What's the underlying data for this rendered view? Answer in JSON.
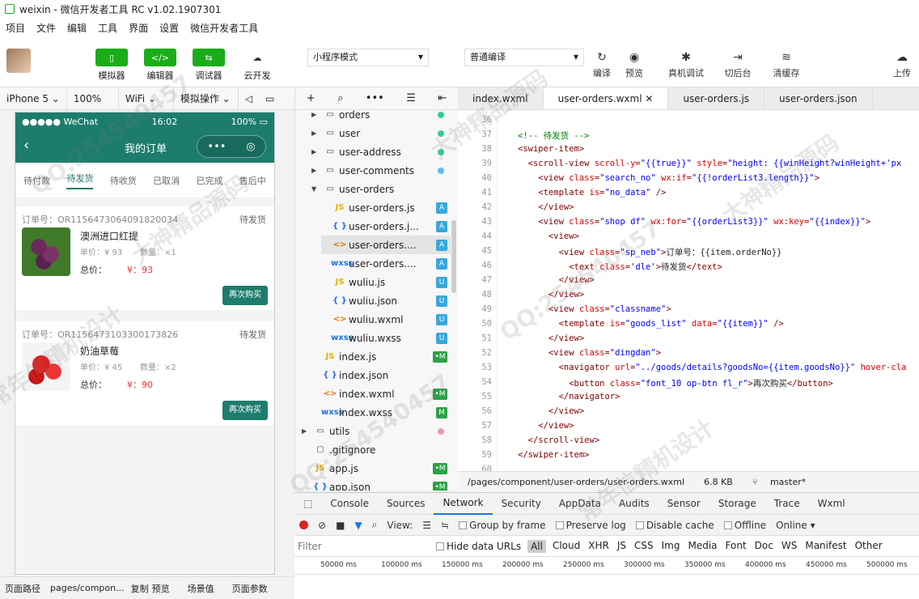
{
  "window": {
    "title": "weixin - 微信开发者工具 RC v1.02.1907301"
  },
  "menu": [
    "项目",
    "文件",
    "编辑",
    "工具",
    "界面",
    "设置",
    "微信开发者工具"
  ],
  "toolbar": {
    "simulator": "模拟器",
    "editor": "编辑器",
    "debugger": "调试器",
    "cloud": "云开发",
    "mode": "小程序模式",
    "compile": "普通编译",
    "compile_btn": "编译",
    "preview": "预览",
    "remote_debug": "真机调试",
    "backend": "切后台",
    "clear_cache": "清缓存",
    "upload": "上传"
  },
  "device_bar": {
    "device": "iPhone 5",
    "zoom": "100%",
    "network": "WiFi",
    "operation": "模拟操作"
  },
  "phone": {
    "status_left": "●●●●● WeChat",
    "time": "16:02",
    "battery": "100%",
    "nav_title": "我的订单",
    "tabs": [
      "待付款",
      "待发货",
      "待收货",
      "已取消",
      "已完成",
      "售后中"
    ],
    "active_tab": "待发货",
    "orders": [
      {
        "order_no": "订单号：OR1156473064091820034",
        "status": "待发货",
        "name": "澳洲进口红提",
        "price": "单价：¥ 93",
        "qty": "数量：×1",
        "total_label": "总价：",
        "total": "¥：93",
        "button": "再次购买"
      },
      {
        "order_no": "订单号：OR1156473103300173826",
        "status": "待发货",
        "name": "奶油草莓",
        "price": "单价：¥ 45",
        "qty": "数量：×2",
        "total_label": "总价：",
        "total": "¥：90",
        "button": "再次购买"
      }
    ]
  },
  "bottom_bar": {
    "path_label": "页面路径",
    "path": "pages/compon...",
    "copy": "复制",
    "preview": "预览",
    "scene": "场景值",
    "params": "页面参数"
  },
  "file_tree": [
    {
      "name": "orders",
      "type": "folder",
      "depth": 1,
      "dot": "#3c9"
    },
    {
      "name": "user",
      "type": "folder",
      "depth": 1,
      "dot": "#3c9"
    },
    {
      "name": "user-address",
      "type": "folder",
      "depth": 1,
      "dot": "#3c9"
    },
    {
      "name": "user-comments",
      "type": "folder",
      "depth": 1,
      "dot": "#5bc0eb"
    },
    {
      "name": "user-orders",
      "type": "folder-open",
      "depth": 1,
      "dot": ""
    },
    {
      "name": "user-orders.js",
      "type": "js",
      "depth": 2,
      "badge": "A"
    },
    {
      "name": "user-orders.j...",
      "type": "json",
      "depth": 2,
      "badge": "A"
    },
    {
      "name": "user-orders....",
      "type": "wxml",
      "depth": 2,
      "badge": "A"
    },
    {
      "name": "user-orders....",
      "type": "wxss",
      "depth": 2,
      "badge": "A"
    },
    {
      "name": "wuliu.js",
      "type": "js",
      "depth": 2,
      "badge": "U"
    },
    {
      "name": "wuliu.json",
      "type": "json",
      "depth": 2,
      "badge": "U"
    },
    {
      "name": "wuliu.wxml",
      "type": "wxml",
      "depth": 2,
      "badge": "U"
    },
    {
      "name": "wuliu.wxss",
      "type": "wxss",
      "depth": 2,
      "badge": "U"
    },
    {
      "name": "index.js",
      "type": "js",
      "depth": 1,
      "badge": "•M"
    },
    {
      "name": "index.json",
      "type": "json",
      "depth": 1,
      "badge": ""
    },
    {
      "name": "index.wxml",
      "type": "wxml",
      "depth": 1,
      "badge": "•M"
    },
    {
      "name": "index.wxss",
      "type": "wxss",
      "depth": 1,
      "badge": "M"
    },
    {
      "name": "utils",
      "type": "folder",
      "depth": 0,
      "dot": "#e9a"
    },
    {
      "name": ".gitignore",
      "type": "file",
      "depth": 0,
      "badge": ""
    },
    {
      "name": "app.js",
      "type": "js",
      "depth": 0,
      "badge": "•M"
    },
    {
      "name": "app.json",
      "type": "json",
      "depth": 0,
      "badge": "•M"
    }
  ],
  "editor_tabs": [
    "index.wxml",
    "user-orders.wxml",
    "user-orders.js",
    "user-orders.json"
  ],
  "active_editor_tab": "user-orders.wxml",
  "code_lines": [
    {
      "n": "36",
      "html": ""
    },
    {
      "n": "37",
      "html": "<span class=\"c\">&lt;!-- 待发货 --&gt;</span>"
    },
    {
      "n": "38",
      "html": "&lt;swiper-item&gt;"
    },
    {
      "n": "39",
      "html": "  &lt;scroll-view <span class=\"a\">scroll-y</span>=<span class=\"v\">\"{{true}}\"</span> <span class=\"a\">style</span>=<span class=\"v\">\"height: {{winHeight?winHeight+'px</span>"
    },
    {
      "n": "40",
      "html": "    &lt;view <span class=\"a\">class</span>=<span class=\"v\">\"search_no\"</span> <span class=\"a\">wx:if</span>=<span class=\"v\">\"{{!orderList3.length}}\"</span>&gt;"
    },
    {
      "n": "41",
      "html": "     &lt;template <span class=\"a\">is</span>=<span class=\"v\">\"no_data\"</span> /&gt;"
    },
    {
      "n": "42",
      "html": "    &lt;/view&gt;"
    },
    {
      "n": "43",
      "html": "    &lt;view <span class=\"a\">class</span>=<span class=\"v\">\"shop df\"</span> <span class=\"a\">wx:for</span>=<span class=\"v\">\"{{orderList3}}\"</span> <span class=\"a\">wx:key</span>=<span class=\"v\">\"{{index}}\"</span>&gt;"
    },
    {
      "n": "44",
      "html": "      &lt;view&gt;"
    },
    {
      "n": "45",
      "html": "        &lt;view <span class=\"a\">class</span>=<span class=\"v\">\"sp_neb\"</span>&gt;<span class=\"t\">订单号：{{item.orderNo}}</span>"
    },
    {
      "n": "46",
      "html": "          &lt;text <span class=\"a\">class</span>=<span class=\"v\">'dle'</span>&gt;<span class=\"t\">待发货</span>&lt;/text&gt;"
    },
    {
      "n": "47",
      "html": "        &lt;/view&gt;"
    },
    {
      "n": "48",
      "html": "      &lt;/view&gt;"
    },
    {
      "n": "49",
      "html": "      &lt;view <span class=\"a\">class</span>=<span class=\"v\">\"classname\"</span>&gt;"
    },
    {
      "n": "50",
      "html": "        &lt;template <span class=\"a\">is</span>=<span class=\"v\">\"goods_list\"</span> <span class=\"a\">data</span>=<span class=\"v\">\"{{item}}\"</span> /&gt;"
    },
    {
      "n": "51",
      "html": "      &lt;/view&gt;"
    },
    {
      "n": "52",
      "html": "      &lt;view <span class=\"a\">class</span>=<span class=\"v\">\"dingdan\"</span>&gt;"
    },
    {
      "n": "53",
      "html": "        &lt;navigator <span class=\"a\">url</span>=<span class=\"v\">\"../goods/details?goodsNo={{item.goodsNo}}\"</span> <span class=\"a\">hover-cla</span>"
    },
    {
      "n": "54",
      "html": "          &lt;button <span class=\"a\">class</span>=<span class=\"v\">\"font_10 op-btn fl_r\"</span>&gt;<span class=\"t\">再次购买</span>&lt;/button&gt;"
    },
    {
      "n": "55",
      "html": "        &lt;/navigator&gt;"
    },
    {
      "n": "56",
      "html": "      &lt;/view&gt;"
    },
    {
      "n": "57",
      "html": "    &lt;/view&gt;"
    },
    {
      "n": "58",
      "html": "  &lt;/scroll-view&gt;"
    },
    {
      "n": "59",
      "html": "&lt;/swiper-item&gt;"
    },
    {
      "n": "60",
      "html": ""
    }
  ],
  "editor_status": {
    "path": "/pages/component/user-orders/user-orders.wxml",
    "size": "6.8 KB",
    "branch": "master*"
  },
  "devtools_tabs": [
    "Console",
    "Sources",
    "Network",
    "Security",
    "AppData",
    "Audits",
    "Sensor",
    "Storage",
    "Trace",
    "Wxml"
  ],
  "active_devtools_tab": "Network",
  "network_toolbar": {
    "view_label": "View:",
    "group": "Group by frame",
    "preserve": "Preserve log",
    "disable_cache": "Disable cache",
    "offline": "Offline",
    "online": "Online"
  },
  "filter": {
    "placeholder": "Filter",
    "hide_data": "Hide data URLs",
    "types": [
      "All",
      "Cloud",
      "XHR",
      "JS",
      "CSS",
      "Img",
      "Media",
      "Font",
      "Doc",
      "WS",
      "Manifest",
      "Other"
    ]
  },
  "timeline_ticks": [
    "50000 ms",
    "100000 ms",
    "150000 ms",
    "200000 ms",
    "250000 ms",
    "300000 ms",
    "350000 ms",
    "400000 ms",
    "450000 ms",
    "500000 ms"
  ],
  "watermarks": [
    "QQ:254540457",
    "大神精品源码",
    "常年信精机设计",
    "QQ:254540457",
    "大神精品源码",
    "常年信精机设计",
    "QQ:254540457",
    "大神精品源码"
  ]
}
